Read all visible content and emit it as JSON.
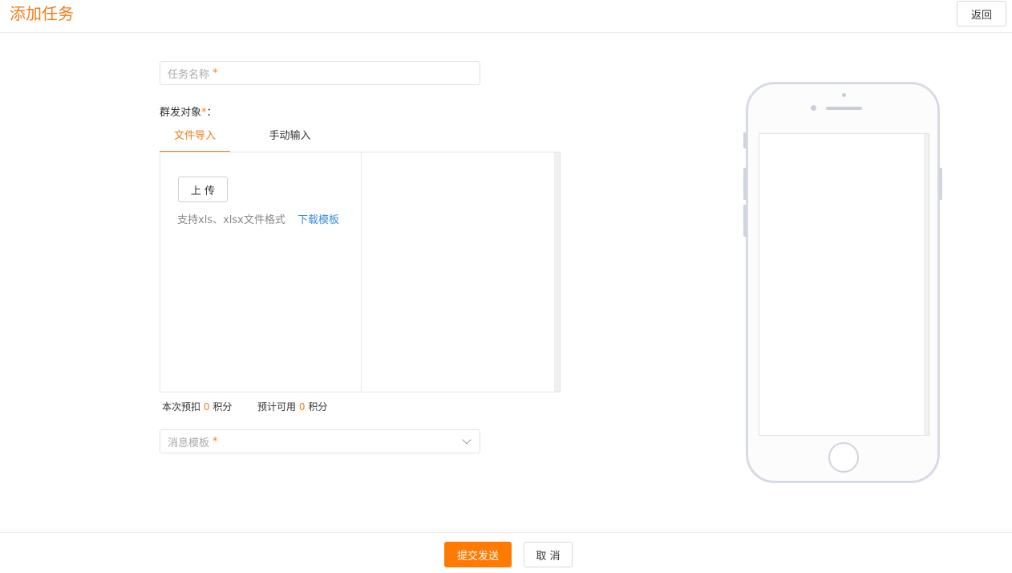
{
  "header": {
    "title": "添加任务",
    "back_label": "返回"
  },
  "form": {
    "task_name_placeholder": "任务名称",
    "required_mark": "*",
    "recipients_label": "群发对象",
    "recipients_colon": "：",
    "tabs": [
      {
        "label": "文件导入",
        "active": true
      },
      {
        "label": "手动输入",
        "active": false
      }
    ],
    "upload_label": "上 传",
    "file_hint": "支持xls、xlsx文件格式",
    "download_template_label": "下载模板",
    "points": {
      "deduct_prefix": "本次预扣",
      "deduct_value": "0",
      "deduct_suffix": "积分",
      "available_prefix": "预计可用",
      "available_value": "0",
      "available_suffix": "积分"
    },
    "message_template_placeholder": "消息模板"
  },
  "footer": {
    "submit_label": "提交发送",
    "cancel_label": "取 消"
  },
  "colors": {
    "accent": "#f47d1a",
    "primary_button": "#ff7a00",
    "link": "#3a8ee6"
  }
}
